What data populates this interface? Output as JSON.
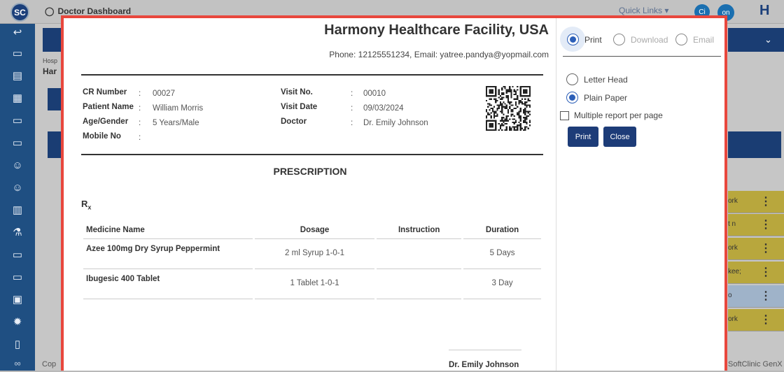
{
  "app": {
    "logo_text": "SC",
    "dashboard_title": "Doctor Dashboard",
    "quick_links": "Quick Links",
    "avatar1": "Ci",
    "avatar2": "on",
    "brand_letter": "H",
    "hospital_label": "Hosp",
    "hospital_value": "Har",
    "footer_left": "Cop",
    "footer_right": "SoftClinic GenX",
    "bg_rows": [
      "ork",
      "t n",
      "ork",
      "kee;",
      "o",
      "ork"
    ]
  },
  "header": {
    "hospital_name": "Harmony Healthcare Facility, USA",
    "contact": "Phone: 12125551234, Email: yatree.pandya@yopmail.com"
  },
  "patient": {
    "cr_label": "CR Number",
    "cr_value": "00027",
    "name_label": "Patient Name",
    "name_value": "William Morris",
    "age_label": "Age/Gender",
    "age_value": "5 Years/Male",
    "mobile_label": "Mobile No",
    "mobile_value": "",
    "visitno_label": "Visit No.",
    "visitno_value": "00010",
    "visitdate_label": "Visit Date",
    "visitdate_value": "09/03/2024",
    "doctor_label": "Doctor",
    "doctor_value": "Dr. Emily Johnson",
    "colon": ":"
  },
  "prescription": {
    "title": "PRESCRIPTION",
    "rx": "R",
    "rx_sub": "x",
    "columns": [
      "Medicine Name",
      "Dosage",
      "Instruction",
      "Duration"
    ],
    "rows": [
      {
        "medicine": "Azee 100mg Dry Syrup Peppermint",
        "dosage": "2 ml Syrup 1-0-1",
        "instruction": "",
        "duration": "5 Days"
      },
      {
        "medicine": "Ibugesic 400 Tablet",
        "dosage": "1 Tablet 1-0-1",
        "instruction": "",
        "duration": "3 Day"
      }
    ],
    "signature": "Dr. Emily Johnson"
  },
  "options": {
    "output_print": "Print",
    "output_download": "Download",
    "output_email": "Email",
    "letter_head": "Letter Head",
    "plain_paper": "Plain Paper",
    "multiple": "Multiple report per page",
    "print_btn": "Print",
    "close_btn": "Close"
  }
}
